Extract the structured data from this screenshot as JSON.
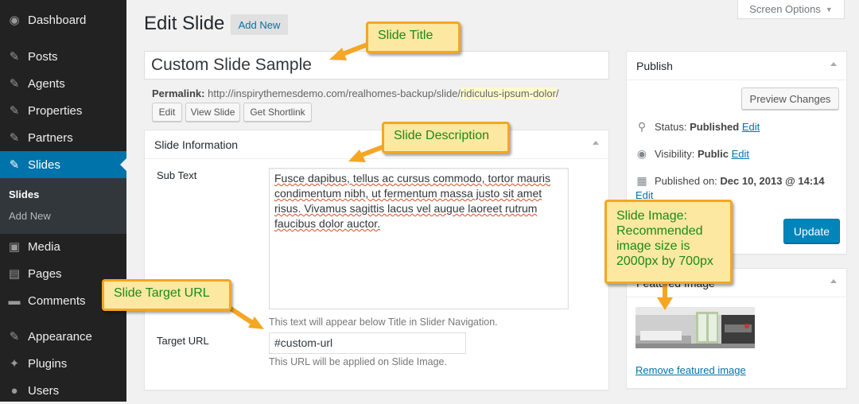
{
  "sidebar": {
    "items": [
      {
        "label": "Dashboard",
        "icon": "dashboard-icon",
        "glyph": "◉"
      },
      {
        "label": "Posts",
        "icon": "pushpin-icon",
        "glyph": "✎"
      },
      {
        "label": "Agents",
        "icon": "pushpin-icon",
        "glyph": "✎"
      },
      {
        "label": "Properties",
        "icon": "pushpin-icon",
        "glyph": "✎"
      },
      {
        "label": "Partners",
        "icon": "pushpin-icon",
        "glyph": "✎"
      },
      {
        "label": "Slides",
        "icon": "pushpin-icon",
        "glyph": "✎"
      },
      {
        "label": "Media",
        "icon": "media-icon",
        "glyph": "▣"
      },
      {
        "label": "Pages",
        "icon": "pages-icon",
        "glyph": "▤"
      },
      {
        "label": "Comments",
        "icon": "comments-icon",
        "glyph": "▬"
      },
      {
        "label": "Appearance",
        "icon": "appearance-icon",
        "glyph": "✎"
      },
      {
        "label": "Plugins",
        "icon": "plugins-icon",
        "glyph": "✦"
      },
      {
        "label": "Users",
        "icon": "users-icon",
        "glyph": "●"
      }
    ],
    "submenu": [
      {
        "label": "Slides"
      },
      {
        "label": "Add New"
      }
    ]
  },
  "header": {
    "title": "Edit Slide",
    "add_new": "Add New",
    "screen_options": "Screen Options"
  },
  "post": {
    "title": "Custom Slide Sample",
    "permalink_label": "Permalink:",
    "permalink_base": "http://inspirythemesdemo.com/realhomes-backup/slide/",
    "permalink_slug": "ridiculus-ipsum-dolor",
    "permalink_tail": "/",
    "buttons": {
      "edit": "Edit",
      "view": "View Slide",
      "shortlink": "Get Shortlink"
    }
  },
  "slide_info": {
    "heading": "Slide Information",
    "sub_text_label": "Sub Text",
    "sub_text_value": "Fusce dapibus, tellus ac cursus commodo, tortor mauris condimentum nibh, ut fermentum massa justo sit amet risus. Vivamus sagittis lacus vel augue laoreet rutrum faucibus dolor auctor.",
    "sub_text_help": "This text will appear below Title in Slider Navigation.",
    "target_label": "Target URL",
    "target_value": "#custom-url",
    "target_help": "This URL will be applied on Slide Image."
  },
  "publish": {
    "heading": "Publish",
    "preview": "Preview Changes",
    "status_label": "Status:",
    "status_value": "Published",
    "visibility_label": "Visibility:",
    "visibility_value": "Public",
    "published_label": "Published on:",
    "published_value": "Dec 10, 2013 @ 14:14",
    "edit": "Edit",
    "update": "Update"
  },
  "featured": {
    "heading": "Featured Image",
    "remove": "Remove featured image"
  },
  "callouts": {
    "title": "Slide Title",
    "description": "Slide Description",
    "target": "Slide Target URL",
    "image_line1": "Slide Image:",
    "image_line2": "Recommended",
    "image_line3": "image size is",
    "image_line4": "2000px by 700px"
  },
  "colors": {
    "accent": "#0073aa",
    "callout_bg": "#fce8a0",
    "callout_border": "#f5a623",
    "callout_text": "#1a8a1a"
  }
}
